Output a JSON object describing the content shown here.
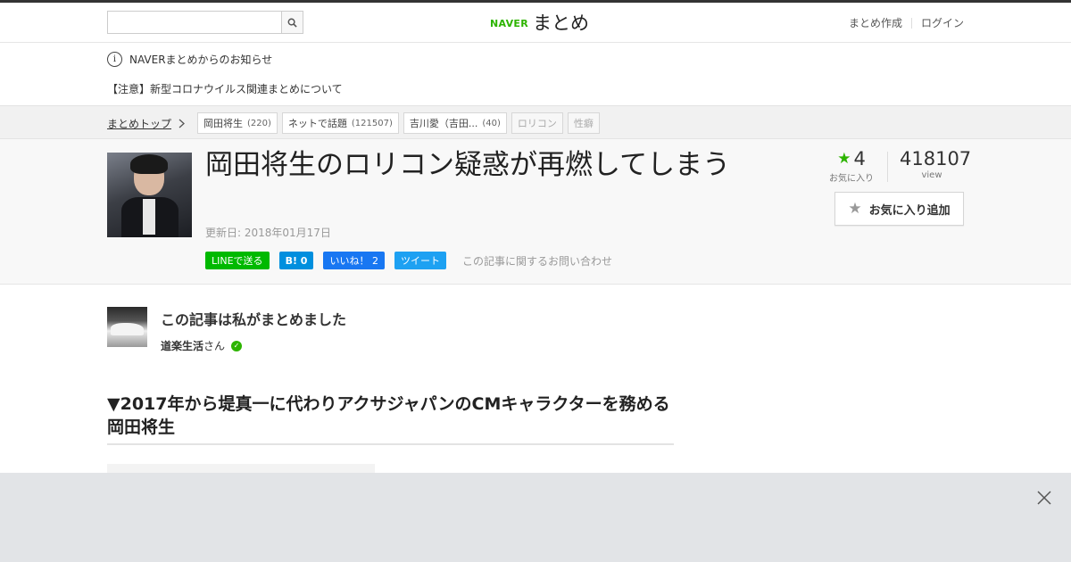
{
  "header": {
    "search_placeholder": "",
    "logo_brand": "NAVER",
    "logo_name": "まとめ",
    "nav": [
      "まとめ作成",
      "ログイン"
    ]
  },
  "notices": {
    "info_glyph": "i",
    "line1": "NAVERまとめからのお知らせ",
    "line2": "【注意】新型コロナウイルス関連まとめについて"
  },
  "breadcrumb": {
    "top": "まとめトップ",
    "tags": [
      {
        "label": "岡田将生",
        "count": "(220)"
      },
      {
        "label": "ネットで話題",
        "count": "(121507)"
      },
      {
        "label": "吉川愛（吉田...",
        "count": "(40)"
      },
      {
        "label": "ロリコン",
        "count": ""
      },
      {
        "label": "性癖",
        "count": ""
      }
    ]
  },
  "article": {
    "title": "岡田将生のロリコン疑惑が再燃してしまう",
    "updated": "更新日: 2018年01月17日",
    "social": {
      "line": "LINEで送る",
      "hatena": "B! 0",
      "fb": "いいね！ 2",
      "tw": "ツイート"
    },
    "contact": "この記事に関するお問い合わせ",
    "fav_count": "4",
    "fav_label": "お気に入り",
    "views": "418107",
    "views_label": "view",
    "fav_button": "お気に入り追加"
  },
  "author": {
    "heading": "この記事は私がまとめました",
    "name": "道楽生活",
    "suffix": "さん"
  },
  "section_heading": "▼2017年から堤真一に代わりアクサジャパンのCMキャラクターを務める岡田将生",
  "colors": {
    "naver_green": "#2db400",
    "line": "#00b900",
    "hatena": "#008fde",
    "facebook": "#1877f2",
    "twitter": "#1da1f2"
  }
}
